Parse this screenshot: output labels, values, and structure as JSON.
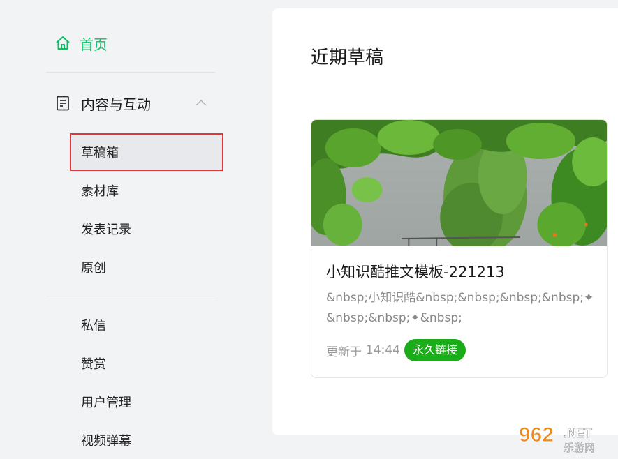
{
  "sidebar": {
    "home_label": "首页",
    "section_label": "内容与互动",
    "sub_items": [
      {
        "label": "草稿箱",
        "active": true
      },
      {
        "label": "素材库"
      },
      {
        "label": "发表记录"
      },
      {
        "label": "原创"
      }
    ],
    "items_group2": [
      {
        "label": "私信"
      },
      {
        "label": "赞赏"
      },
      {
        "label": "用户管理"
      },
      {
        "label": "视频弹幕"
      }
    ]
  },
  "main": {
    "title": "近期草稿",
    "draft_card": {
      "title": "小知识酷推文模板-221213",
      "excerpt": "&nbsp;小知识酷&nbsp;&nbsp;&nbsp;&nbsp;✦&nbsp;&nbsp;✦&nbsp;",
      "updated_prefix": "更新于",
      "updated_time": "14:44",
      "permalink_label": "永久链接"
    }
  },
  "watermark": {
    "number": "962",
    "domain": ".NET",
    "chinese": "乐游网"
  },
  "colors": {
    "accent": "#07c160",
    "badge": "#1aad19",
    "highlight_border": "#e0353b"
  }
}
